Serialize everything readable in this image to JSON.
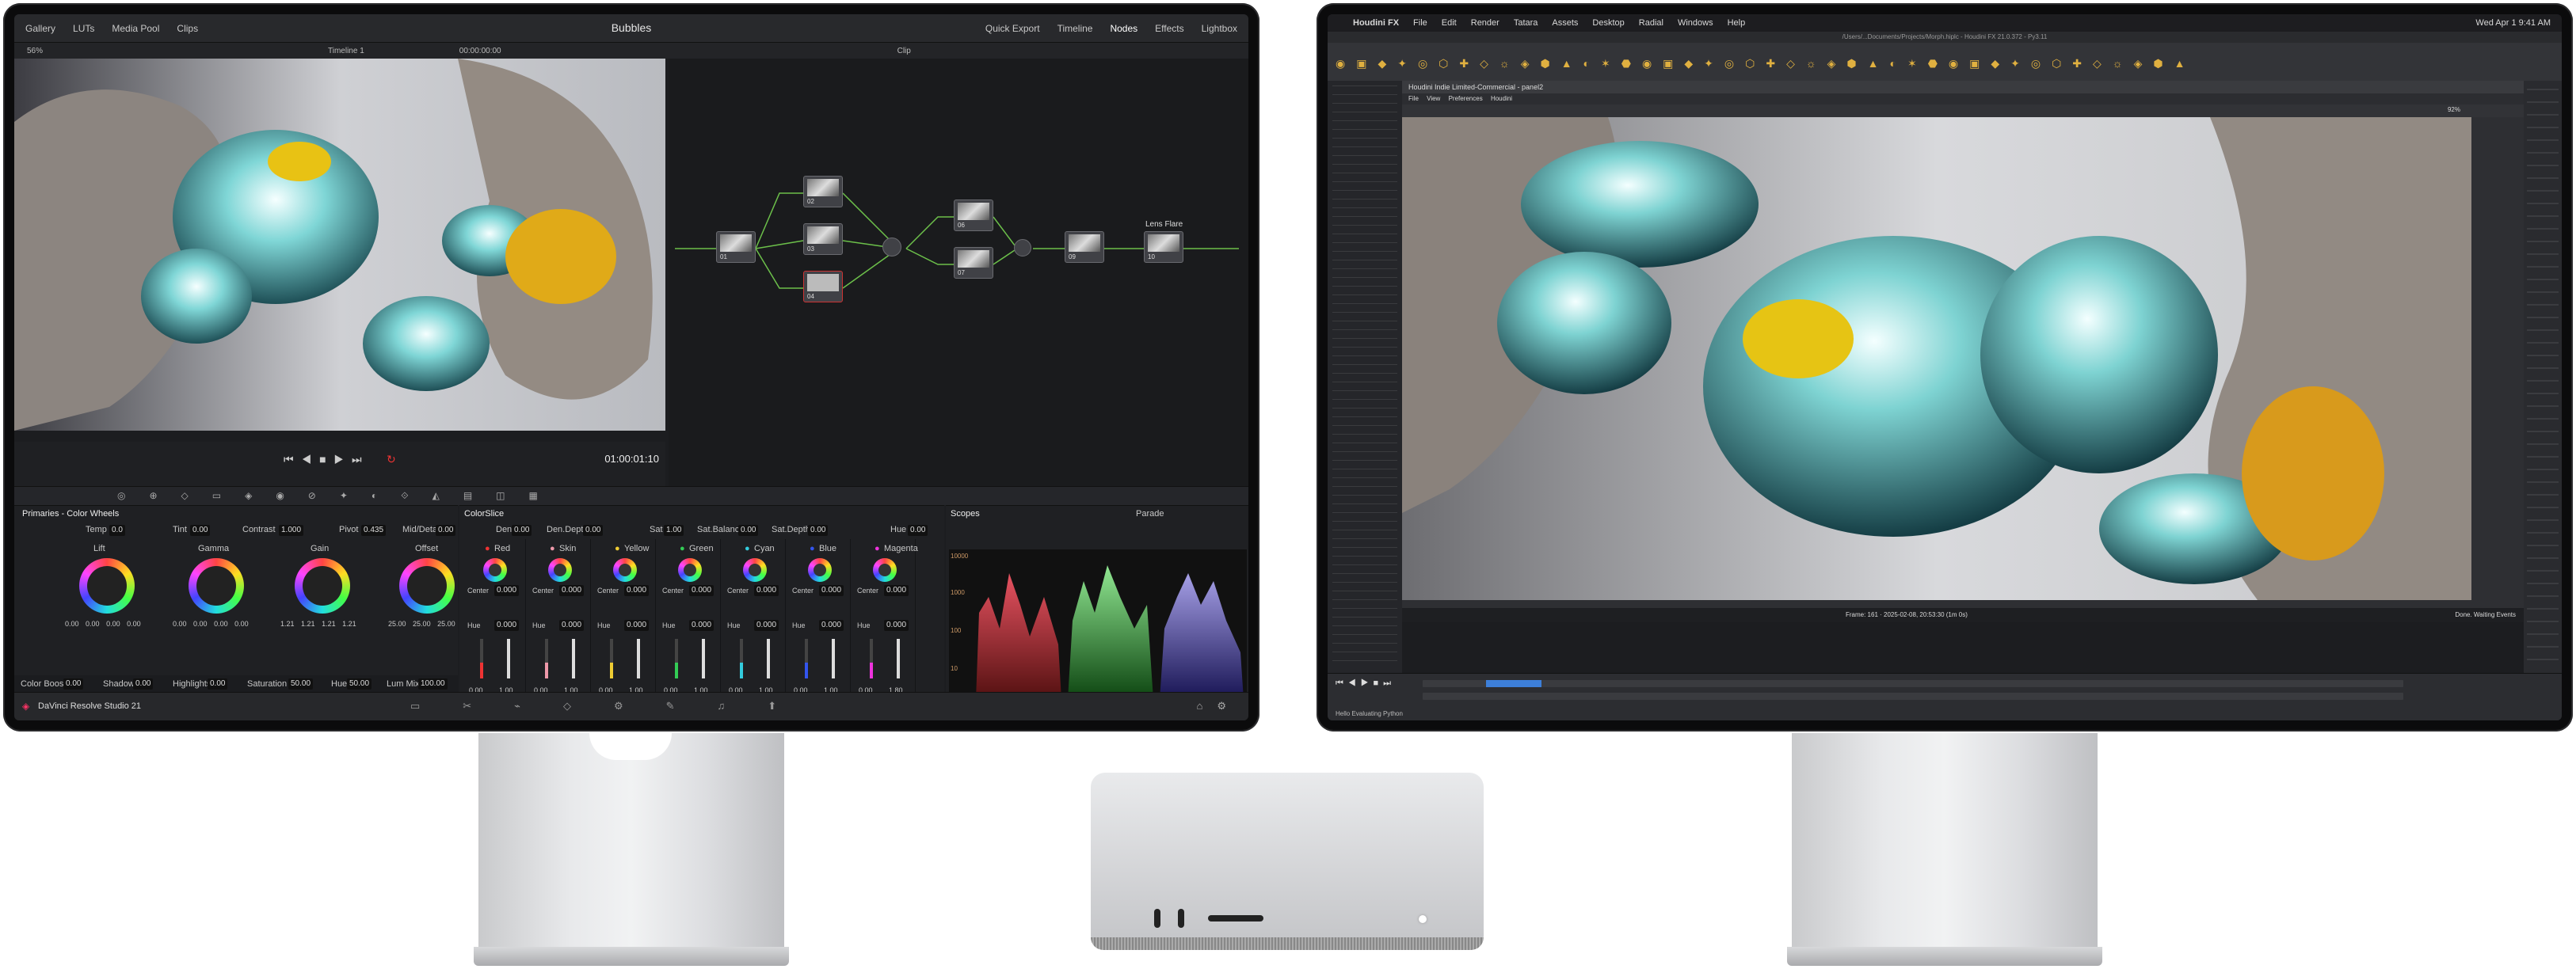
{
  "resolve": {
    "top_tabs_left": [
      "Gallery",
      "LUTs",
      "Media Pool",
      "Clips"
    ],
    "project_title": "Bubbles",
    "top_tabs_right": [
      "Quick Export",
      "Timeline",
      "Nodes",
      "Effects",
      "Lightbox"
    ],
    "zoom": "56%",
    "timeline_name": "Timeline 1",
    "timecode_start": "00:00:00:00",
    "node_mode": "Clip",
    "timecode": "01:00:01:10",
    "nodes": [
      "01",
      "02",
      "03",
      "04",
      "05",
      "06",
      "07",
      "08",
      "09",
      "10"
    ],
    "lens_flare_label": "Lens Flare",
    "primaries_title": "Primaries - Color Wheels",
    "temp_label": "Temp",
    "temp_value": "0.0",
    "tint_label": "Tint",
    "tint_value": "0.00",
    "contrast_label": "Contrast",
    "contrast_value": "1.000",
    "pivot_label": "Pivot",
    "pivot_value": "0.435",
    "middetail_label": "Mid/Detail",
    "middetail_value": "0.00",
    "wheels": [
      {
        "name": "Lift",
        "values": [
          "0.00",
          "0.00",
          "0.00",
          "0.00"
        ]
      },
      {
        "name": "Gamma",
        "values": [
          "0.00",
          "0.00",
          "0.00",
          "0.00"
        ]
      },
      {
        "name": "Gain",
        "values": [
          "1.21",
          "1.21",
          "1.21",
          "1.21"
        ]
      },
      {
        "name": "Offset",
        "values": [
          "25.00",
          "25.00",
          "25.00"
        ]
      }
    ],
    "bottom_params": [
      {
        "label": "Color Boost",
        "value": "0.00"
      },
      {
        "label": "Shadows",
        "value": "0.00"
      },
      {
        "label": "Highlights",
        "value": "0.00"
      },
      {
        "label": "Saturation",
        "value": "50.00"
      },
      {
        "label": "Hue",
        "value": "50.00"
      },
      {
        "label": "Lum Mix",
        "value": "100.00"
      }
    ],
    "colorslice_title": "ColorSlice",
    "colorslice_top": [
      {
        "label": "Den",
        "value": "0.00"
      },
      {
        "label": "Den.Depth",
        "value": "0.00"
      },
      {
        "label": "Sat",
        "value": "1.00"
      },
      {
        "label": "Sat.Balance",
        "value": "0.00"
      },
      {
        "label": "Sat.Depth",
        "value": "0.00"
      },
      {
        "label": "Hue",
        "value": "0.00"
      }
    ],
    "slices": [
      {
        "name": "Red",
        "center": "0.000",
        "hue": "0.000",
        "a": "0.00",
        "b": "1.00"
      },
      {
        "name": "Skin",
        "center": "0.000",
        "hue": "0.000",
        "a": "0.00",
        "b": "1.00"
      },
      {
        "name": "Yellow",
        "center": "0.000",
        "hue": "0.000",
        "a": "0.00",
        "b": "1.00"
      },
      {
        "name": "Green",
        "center": "0.000",
        "hue": "0.000",
        "a": "0.00",
        "b": "1.00"
      },
      {
        "name": "Cyan",
        "center": "0.000",
        "hue": "0.000",
        "a": "0.00",
        "b": "1.00"
      },
      {
        "name": "Blue",
        "center": "0.000",
        "hue": "0.000",
        "a": "0.00",
        "b": "1.00"
      },
      {
        "name": "Magenta",
        "center": "0.000",
        "hue": "0.000",
        "a": "0.00",
        "b": "1.80"
      }
    ],
    "center_label": "Center",
    "hue_label": "Hue",
    "scopes_title": "Scopes",
    "scopes_mode": "Parade",
    "scope_ticks": [
      "10000",
      "1000",
      "100",
      "10",
      "0"
    ],
    "brand": "DaVinci Resolve Studio 21"
  },
  "houdini": {
    "menu": [
      "Houdini FX",
      "File",
      "Edit",
      "Render",
      "Tatara",
      "Assets",
      "Desktop",
      "Radial",
      "Windows",
      "Help"
    ],
    "clock": "Wed Apr 1  9:41 AM",
    "path_title": "/Users/...Documents/Projects/Morph.hiplc - Houdini FX 21.0.372 - Py3.11",
    "window_title": "Houdini Indie Limited-Commercial - panel2",
    "panel_tabs": [
      "File",
      "View",
      "Preferences",
      "Houdini"
    ],
    "viewport_zoom": "92%",
    "frame_info": "Frame: 161 · 2025-02-08, 20:53:30 (1m 0s)",
    "status_right": "Done. Waiting Events",
    "footer": "Hello Evaluating Python"
  }
}
